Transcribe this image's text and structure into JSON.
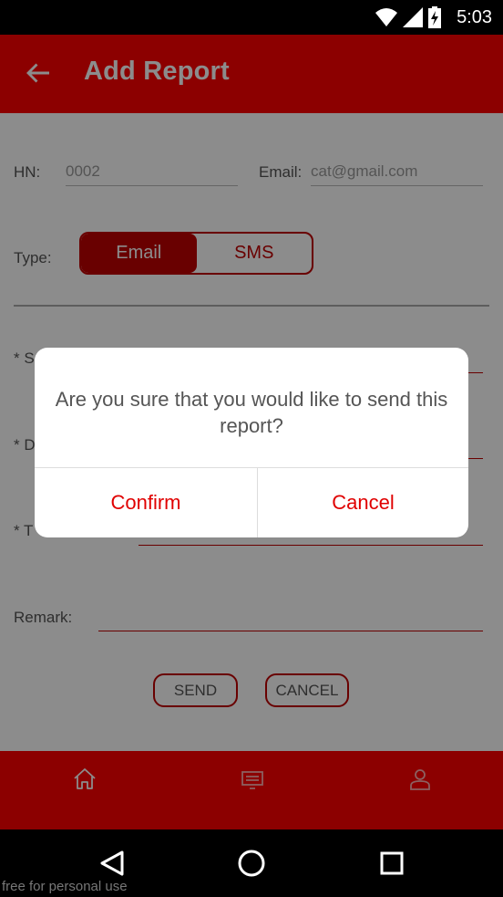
{
  "status_bar": {
    "time": "5:03",
    "icons": [
      "wifi-icon",
      "signal-icon",
      "battery-charging-icon"
    ]
  },
  "app_bar": {
    "title": "Add Report",
    "back_icon": "arrow-left-icon"
  },
  "form": {
    "hn_label": "HN:",
    "hn_value": "0002",
    "email_label": "Email:",
    "email_placeholder": "cat@gmail.com",
    "type_label": "Type:",
    "type_options": [
      "Email",
      "SMS"
    ],
    "type_selected": "Email",
    "field_prefix_1": "* S",
    "field_prefix_2": "* D",
    "field_prefix_3": "* T",
    "remark_label": "Remark:",
    "send_label": "SEND",
    "cancel_label": "CANCEL"
  },
  "dialog": {
    "message": "Are you sure that you would like to send this report?",
    "confirm_label": "Confirm",
    "cancel_label": "Cancel"
  },
  "bottom_nav": {
    "items": [
      "home-icon",
      "report-icon",
      "profile-icon"
    ],
    "active": "home-icon"
  },
  "system_nav": {
    "items": [
      "back-triangle-icon",
      "home-circle-icon",
      "recents-square-icon"
    ]
  },
  "watermark": "free for personal use",
  "colors": {
    "primary": "#ff0000",
    "accent": "#c00000",
    "dialog_button": "#e00000"
  }
}
